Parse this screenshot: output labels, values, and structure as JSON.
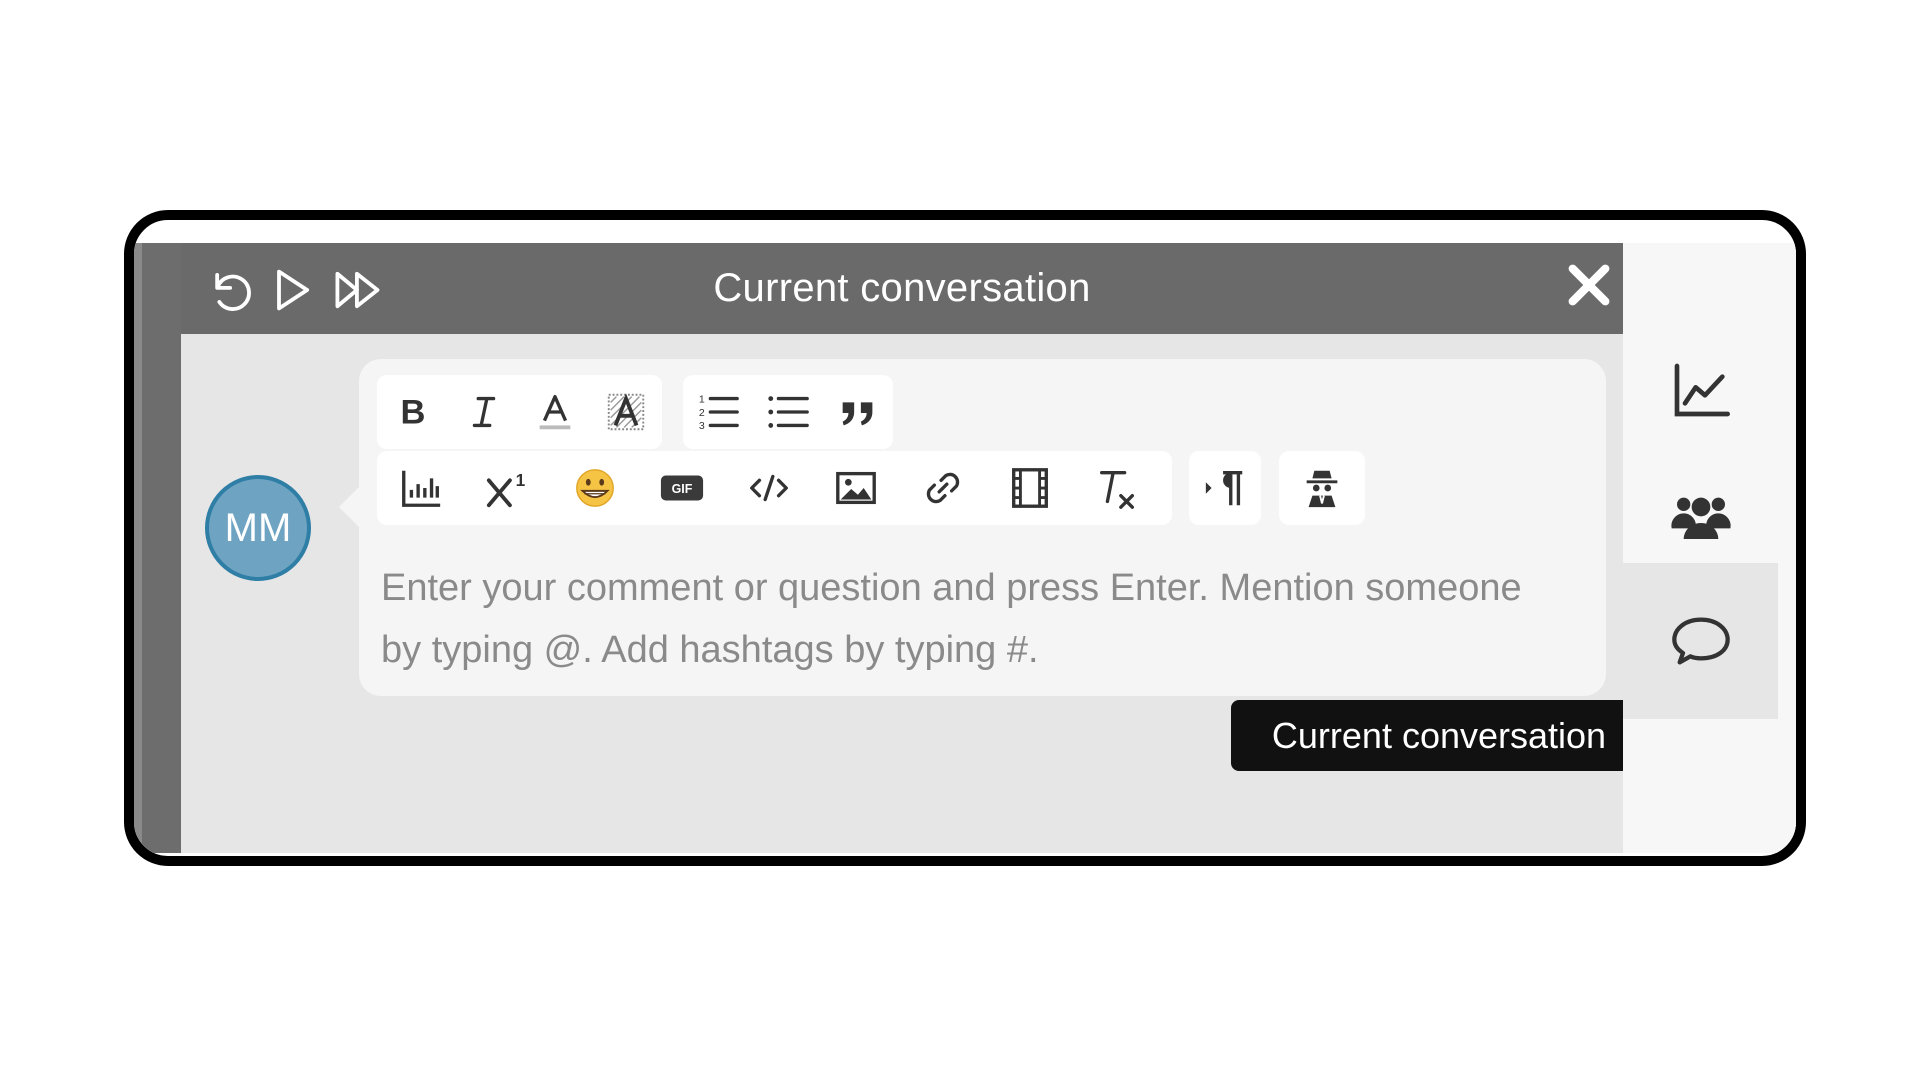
{
  "header": {
    "title": "Current conversation",
    "buttons": [
      {
        "icon": "undo-icon"
      },
      {
        "icon": "play-icon"
      },
      {
        "icon": "fast-forward-icon"
      }
    ],
    "close_icon": "close-icon"
  },
  "avatar": {
    "initials": "MM",
    "color": "#6fa3c2",
    "border": "#2e7ea6"
  },
  "editor": {
    "placeholder": "Enter your comment or question and press Enter. Mention someone by typing @. Add hashtags by typing #.",
    "toolbar_row1_groups": [
      [
        "bold-icon",
        "italic-icon",
        "text-color-icon",
        "highlight-color-icon"
      ],
      [
        "ordered-list-icon",
        "bullet-list-icon",
        "blockquote-icon"
      ]
    ],
    "toolbar_row2_groups": [
      [
        "chart-icon",
        "superscript-icon",
        "emoji-icon",
        "gif-icon",
        "code-icon",
        "image-icon",
        "link-icon",
        "video-icon",
        "clear-format-icon"
      ],
      [
        "paragraph-icon"
      ],
      [
        "anonymous-icon"
      ]
    ],
    "gif_label": "GIF"
  },
  "sidebar": {
    "items": [
      {
        "icon": "analytics-chart-icon"
      },
      {
        "icon": "people-icon"
      },
      {
        "icon": "chat-bubble-icon",
        "active": true
      }
    ]
  },
  "tooltip": {
    "text": "Current conversation"
  },
  "colors": {
    "titlebar": "#6a6a6a",
    "panel": "#e6e6e6",
    "tooltip": "#111111"
  }
}
